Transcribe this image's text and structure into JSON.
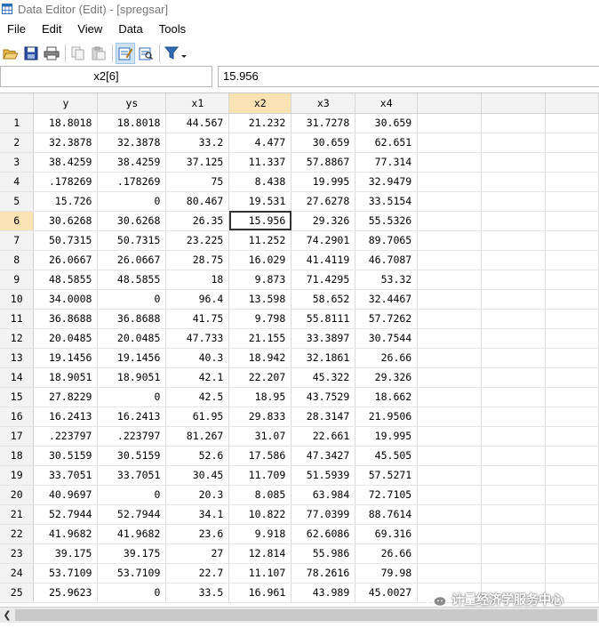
{
  "window": {
    "title": "Data Editor (Edit) - [spregsar]"
  },
  "menu": [
    "File",
    "Edit",
    "View",
    "Data",
    "Tools"
  ],
  "formula": {
    "cell_ref": "x2[6]",
    "value": "15.956"
  },
  "columns": [
    "y",
    "ys",
    "x1",
    "x2",
    "x3",
    "x4"
  ],
  "selected_column": "x2",
  "selected_row": 6,
  "rows": [
    [
      "1",
      "18.8018",
      "18.8018",
      "44.567",
      "21.232",
      "31.7278",
      "30.659"
    ],
    [
      "2",
      "32.3878",
      "32.3878",
      "33.2",
      "4.477",
      "30.659",
      "62.651"
    ],
    [
      "3",
      "38.4259",
      "38.4259",
      "37.125",
      "11.337",
      "57.8867",
      "77.314"
    ],
    [
      "4",
      ".178269",
      ".178269",
      "75",
      "8.438",
      "19.995",
      "32.9479"
    ],
    [
      "5",
      "15.726",
      "0",
      "80.467",
      "19.531",
      "27.6278",
      "33.5154"
    ],
    [
      "6",
      "30.6268",
      "30.6268",
      "26.35",
      "15.956",
      "29.326",
      "55.5326"
    ],
    [
      "7",
      "50.7315",
      "50.7315",
      "23.225",
      "11.252",
      "74.2901",
      "89.7065"
    ],
    [
      "8",
      "26.0667",
      "26.0667",
      "28.75",
      "16.029",
      "41.4119",
      "46.7087"
    ],
    [
      "9",
      "48.5855",
      "48.5855",
      "18",
      "9.873",
      "71.4295",
      "53.32"
    ],
    [
      "10",
      "34.0008",
      "0",
      "96.4",
      "13.598",
      "58.652",
      "32.4467"
    ],
    [
      "11",
      "36.8688",
      "36.8688",
      "41.75",
      "9.798",
      "55.8111",
      "57.7262"
    ],
    [
      "12",
      "20.0485",
      "20.0485",
      "47.733",
      "21.155",
      "33.3897",
      "30.7544"
    ],
    [
      "13",
      "19.1456",
      "19.1456",
      "40.3",
      "18.942",
      "32.1861",
      "26.66"
    ],
    [
      "14",
      "18.9051",
      "18.9051",
      "42.1",
      "22.207",
      "45.322",
      "29.326"
    ],
    [
      "15",
      "27.8229",
      "0",
      "42.5",
      "18.95",
      "43.7529",
      "18.662"
    ],
    [
      "16",
      "16.2413",
      "16.2413",
      "61.95",
      "29.833",
      "28.3147",
      "21.9506"
    ],
    [
      "17",
      ".223797",
      ".223797",
      "81.267",
      "31.07",
      "22.661",
      "19.995"
    ],
    [
      "18",
      "30.5159",
      "30.5159",
      "52.6",
      "17.586",
      "47.3427",
      "45.505"
    ],
    [
      "19",
      "33.7051",
      "33.7051",
      "30.45",
      "11.709",
      "51.5939",
      "57.5271"
    ],
    [
      "20",
      "40.9697",
      "0",
      "20.3",
      "8.085",
      "63.984",
      "72.7105"
    ],
    [
      "21",
      "52.7944",
      "52.7944",
      "34.1",
      "10.822",
      "77.0399",
      "88.7614"
    ],
    [
      "22",
      "41.9682",
      "41.9682",
      "23.6",
      "9.918",
      "62.6086",
      "69.316"
    ],
    [
      "23",
      "39.175",
      "39.175",
      "27",
      "12.814",
      "55.986",
      "26.66"
    ],
    [
      "24",
      "53.7109",
      "53.7109",
      "22.7",
      "11.107",
      "78.2616",
      "79.98"
    ],
    [
      "25",
      "25.9623",
      "0",
      "33.5",
      "16.961",
      "43.989",
      "45.0027"
    ]
  ],
  "watermark": {
    "text": "计量经济学服务中心"
  },
  "icons": {
    "toolbar": [
      "open-folder-icon",
      "save-icon",
      "print-icon",
      "copy-icon",
      "paste-icon",
      "edit-mode-icon",
      "browse-mode-icon",
      "filter-icon"
    ]
  }
}
